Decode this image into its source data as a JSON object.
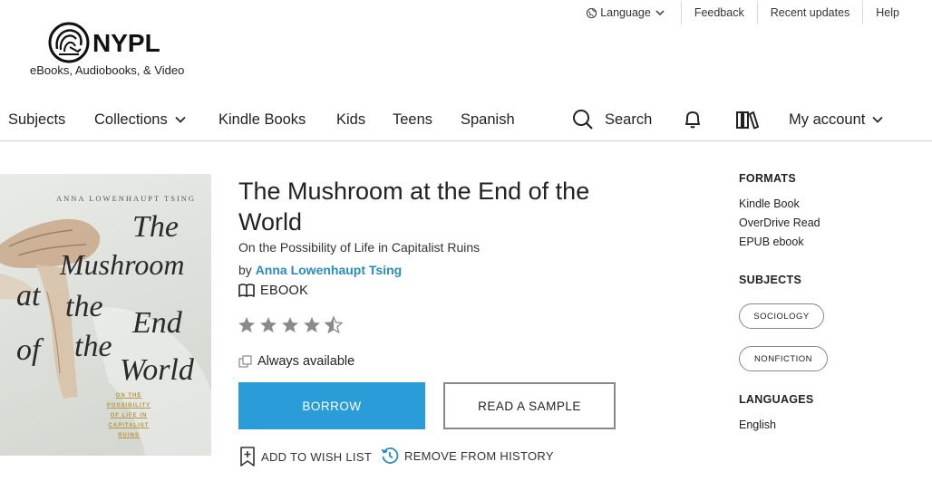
{
  "utility_bar": {
    "language": "Language",
    "feedback": "Feedback",
    "recent_updates": "Recent updates",
    "help": "Help"
  },
  "logo": {
    "name": "NYPL",
    "tagline": "eBooks, Audiobooks, & Video"
  },
  "nav": {
    "subjects": "Subjects",
    "collections": "Collections",
    "kindle_books": "Kindle Books",
    "kids": "Kids",
    "teens": "Teens",
    "spanish": "Spanish",
    "search": "Search",
    "my_account": "My account"
  },
  "cover": {
    "author": "ANNA LOWENHAUPT TSING",
    "words": [
      "The",
      "Mushroom",
      "at",
      "the",
      "End",
      "of",
      "the",
      "World"
    ],
    "subtitle_lines": [
      "ON THE",
      "POSSIBILITY",
      "OF LIFE IN",
      "CAPITALIST",
      "RUINS"
    ]
  },
  "book": {
    "title": "The Mushroom at the End of the World",
    "subtitle": "On the Possibility of Life in Capitalist Ruins",
    "by_prefix": "by",
    "author": "Anna Lowenhaupt Tsing",
    "format": "EBOOK",
    "rating": 4.5,
    "rating_max": 5,
    "availability": "Always available"
  },
  "actions": {
    "borrow": "BORROW",
    "read_sample": "READ A SAMPLE",
    "wish_list": "ADD TO WISH LIST",
    "remove_history": "REMOVE FROM HISTORY"
  },
  "sidebar": {
    "formats_heading": "FORMATS",
    "formats": [
      "Kindle Book",
      "OverDrive Read",
      "EPUB ebook"
    ],
    "subjects_heading": "SUBJECTS",
    "subjects": [
      "SOCIOLOGY",
      "NONFICTION"
    ],
    "languages_heading": "LANGUAGES",
    "languages": [
      "English"
    ]
  },
  "colors": {
    "accent": "#2a9dd8",
    "link": "#2a8bc0",
    "star": "#8a8a8a",
    "cover_subtitle": "#b5953f"
  }
}
